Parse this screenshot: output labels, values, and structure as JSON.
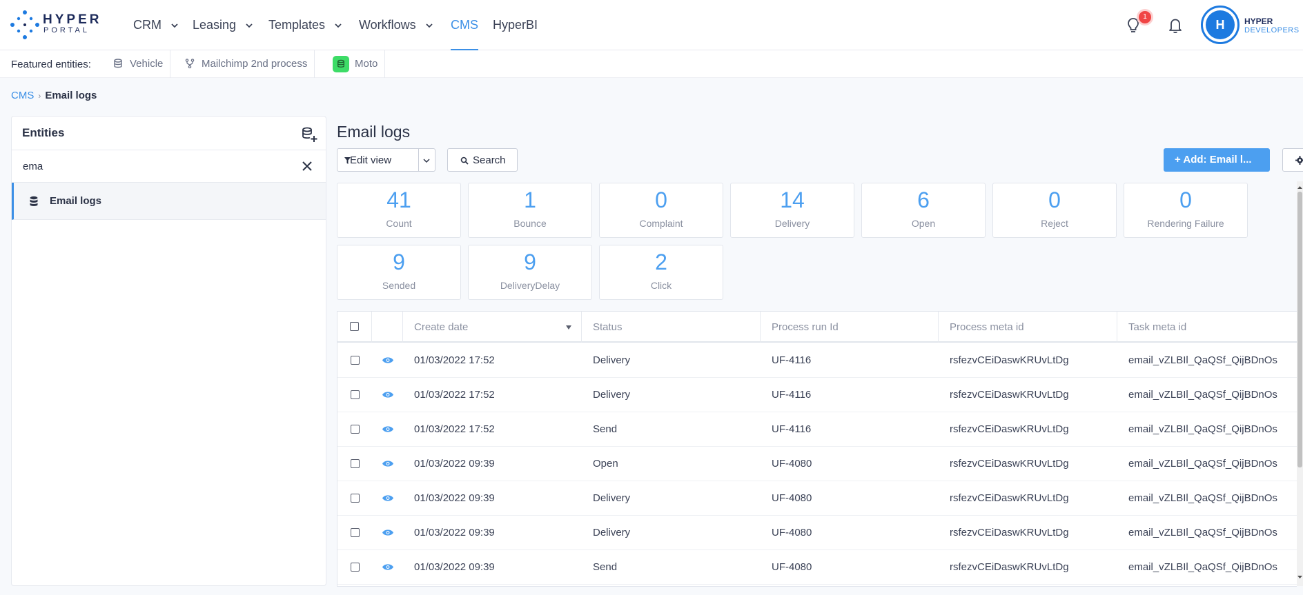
{
  "brand": {
    "name": "HYPER",
    "sub": "PORTAL"
  },
  "nav": {
    "items": [
      {
        "label": "CRM",
        "dropdown": true
      },
      {
        "label": "Leasing",
        "dropdown": true
      },
      {
        "label": "Templates",
        "dropdown": true
      },
      {
        "label": "Workflows",
        "dropdown": true
      },
      {
        "label": "CMS",
        "dropdown": false,
        "active": true
      },
      {
        "label": "HyperBI",
        "dropdown": false
      }
    ],
    "notification_count": "1"
  },
  "user": {
    "avatar_letter": "H",
    "company_line1": "HYPER",
    "company_line2": "DEVELOPERS"
  },
  "featured": {
    "label": "Featured entities:",
    "items": [
      {
        "label": "Vehicle",
        "icon": "database-icon"
      },
      {
        "label": "Mailchimp 2nd process",
        "icon": "process-icon"
      },
      {
        "label": "Moto",
        "icon": "database-icon",
        "icon_bg": "#3ddc67"
      }
    ]
  },
  "breadcrumb": {
    "parent": "CMS",
    "current": "Email logs"
  },
  "entities": {
    "title": "Entities",
    "search_value": "ema",
    "items": [
      {
        "label": "Email logs",
        "selected": true
      }
    ]
  },
  "main": {
    "title": "Email logs",
    "edit_view_label": "Edit view",
    "search_label": "Search",
    "add_label": "+ Add: Email l..."
  },
  "stats": [
    {
      "value": "41",
      "label": "Count"
    },
    {
      "value": "1",
      "label": "Bounce"
    },
    {
      "value": "0",
      "label": "Complaint"
    },
    {
      "value": "14",
      "label": "Delivery"
    },
    {
      "value": "6",
      "label": "Open"
    },
    {
      "value": "0",
      "label": "Reject"
    },
    {
      "value": "0",
      "label": "Rendering Failure"
    },
    {
      "value": "9",
      "label": "Sended"
    },
    {
      "value": "9",
      "label": "DeliveryDelay"
    },
    {
      "value": "2",
      "label": "Click"
    }
  ],
  "table": {
    "columns": [
      "Create date",
      "Status",
      "Process run Id",
      "Process meta id",
      "Task meta id"
    ],
    "rows": [
      [
        "01/03/2022 17:52",
        "Delivery",
        "UF-4116",
        "rsfezvCEiDaswKRUvLtDg",
        "email_vZLBIl_QaQSf_QijBDnOs"
      ],
      [
        "01/03/2022 17:52",
        "Delivery",
        "UF-4116",
        "rsfezvCEiDaswKRUvLtDg",
        "email_vZLBIl_QaQSf_QijBDnOs"
      ],
      [
        "01/03/2022 17:52",
        "Send",
        "UF-4116",
        "rsfezvCEiDaswKRUvLtDg",
        "email_vZLBIl_QaQSf_QijBDnOs"
      ],
      [
        "01/03/2022 09:39",
        "Open",
        "UF-4080",
        "rsfezvCEiDaswKRUvLtDg",
        "email_vZLBIl_QaQSf_QijBDnOs"
      ],
      [
        "01/03/2022 09:39",
        "Delivery",
        "UF-4080",
        "rsfezvCEiDaswKRUvLtDg",
        "email_vZLBIl_QaQSf_QijBDnOs"
      ],
      [
        "01/03/2022 09:39",
        "Delivery",
        "UF-4080",
        "rsfezvCEiDaswKRUvLtDg",
        "email_vZLBIl_QaQSf_QijBDnOs"
      ],
      [
        "01/03/2022 09:39",
        "Send",
        "UF-4080",
        "rsfezvCEiDaswKRUvLtDg",
        "email_vZLBIl_QaQSf_QijBDnOs"
      ]
    ]
  },
  "colors": {
    "accent": "#3b8fe6",
    "primary_button": "#4c9ff0",
    "badge": "#f04444"
  }
}
